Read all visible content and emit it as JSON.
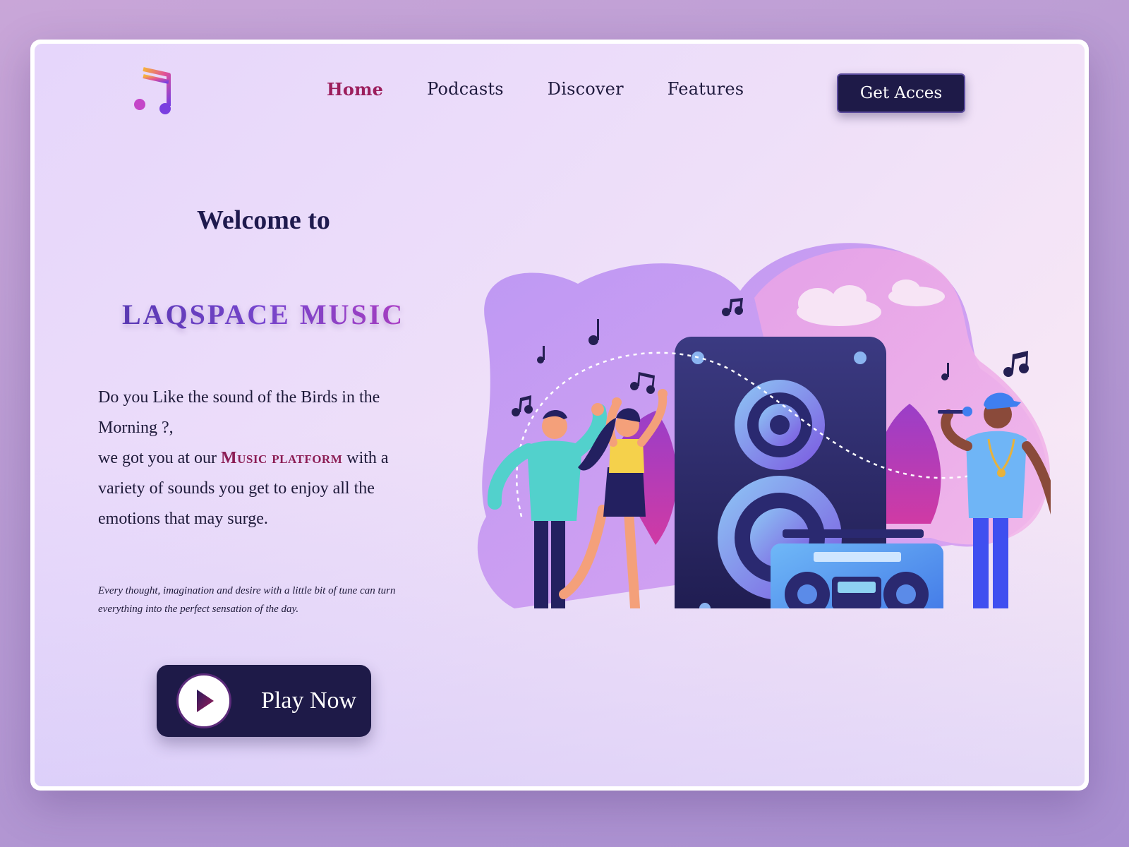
{
  "nav": {
    "items": [
      {
        "label": "Home",
        "active": true
      },
      {
        "label": "Podcasts",
        "active": false
      },
      {
        "label": "Discover",
        "active": false
      },
      {
        "label": "Features",
        "active": false
      }
    ],
    "cta_label": "Get Acces"
  },
  "hero": {
    "welcome": "Welcome to",
    "brand": "LAQSPACE MUSIC",
    "desc_line1": "Do you Like the sound of the Birds in the Morning ?,",
    "desc_line2_pre": "we got you at our",
    "desc_highlight": "Music platform",
    "desc_line2_post": "with a variety of sounds you get to enjoy all the emotions that may surge.",
    "quote": "Every thought, imagination and desire with a little bit of tune can turn everything into the perfect sensation of the day.",
    "play_label": "Play Now"
  },
  "colors": {
    "accent": "#9c1e5c",
    "button_bg": "#1e1a48",
    "text_dark": "#1f1a3e"
  },
  "icons": {
    "logo": "music-note-icon",
    "play": "play-icon"
  }
}
